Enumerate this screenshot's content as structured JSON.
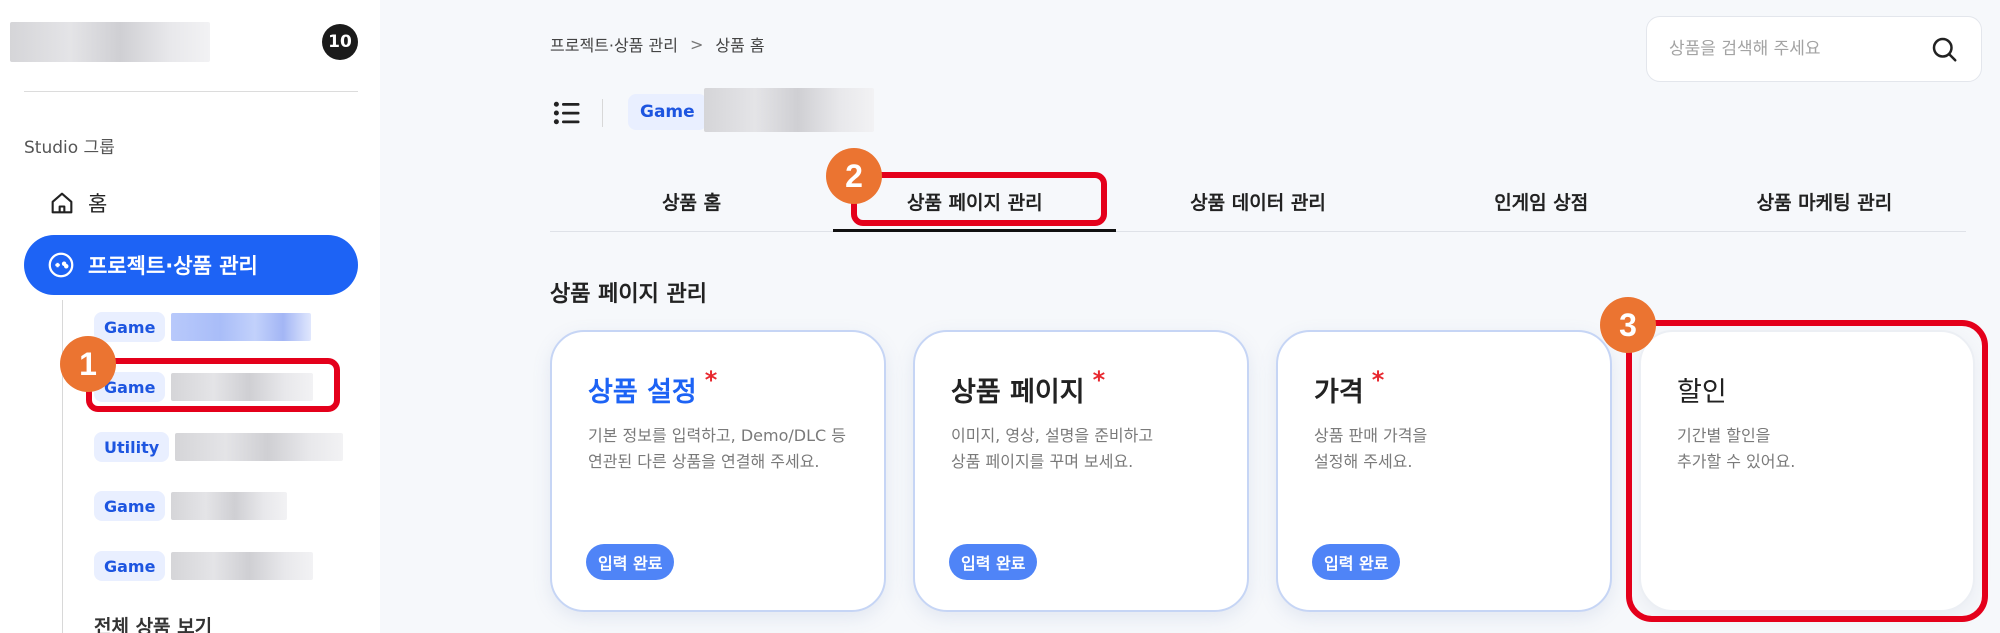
{
  "sidebar": {
    "count_badge": "10",
    "group_label": "Studio 그룹",
    "home_label": "홈",
    "active_label": "프로젝트·상품 관리",
    "sub_items": [
      {
        "tag": "Game"
      },
      {
        "tag": "Game"
      },
      {
        "tag": "Utility"
      },
      {
        "tag": "Game"
      },
      {
        "tag": "Game"
      }
    ],
    "all_products_label": "전체 상품 보기"
  },
  "breadcrumb": {
    "items": [
      "프로젝트·상품 관리",
      "상품 홈"
    ],
    "separator": ">"
  },
  "search": {
    "placeholder": "상품을 검색해 주세요"
  },
  "product_header": {
    "tag": "Game"
  },
  "tabs": [
    {
      "label": "상품 홈"
    },
    {
      "label": "상품 페이지 관리"
    },
    {
      "label": "상품 데이터 관리"
    },
    {
      "label": "인게임 상점"
    },
    {
      "label": "상품 마케팅 관리"
    }
  ],
  "active_tab": "상품 페이지 관리",
  "section_title": "상품 페이지 관리",
  "cards": [
    {
      "title": "상품 설정",
      "required": "*",
      "desc_line1": "기본 정보를 입력하고, Demo/DLC 등",
      "desc_line2": "연관된 다른 상품을 연결해 주세요.",
      "badge": "입력 완료"
    },
    {
      "title": "상품 페이지",
      "required": "*",
      "desc_line1": "이미지, 영상, 설명을 준비하고",
      "desc_line2": "상품 페이지를 꾸며 보세요.",
      "badge": "입력 완료"
    },
    {
      "title": "가격",
      "required": "*",
      "desc_line1": "상품 판매 가격을",
      "desc_line2": "설정해 주세요.",
      "badge": "입력 완료"
    },
    {
      "title": "할인",
      "desc_line1": "기간별 할인을",
      "desc_line2": "추가할 수 있어요."
    }
  ],
  "annotations": {
    "markers": [
      "1",
      "2",
      "3"
    ],
    "marker_color": "#eb7431",
    "highlight_color": "#e4001b"
  },
  "colors": {
    "accent": "#1d63f5",
    "badge_blue": "#4f84f7",
    "required_star": "#e8282f"
  }
}
